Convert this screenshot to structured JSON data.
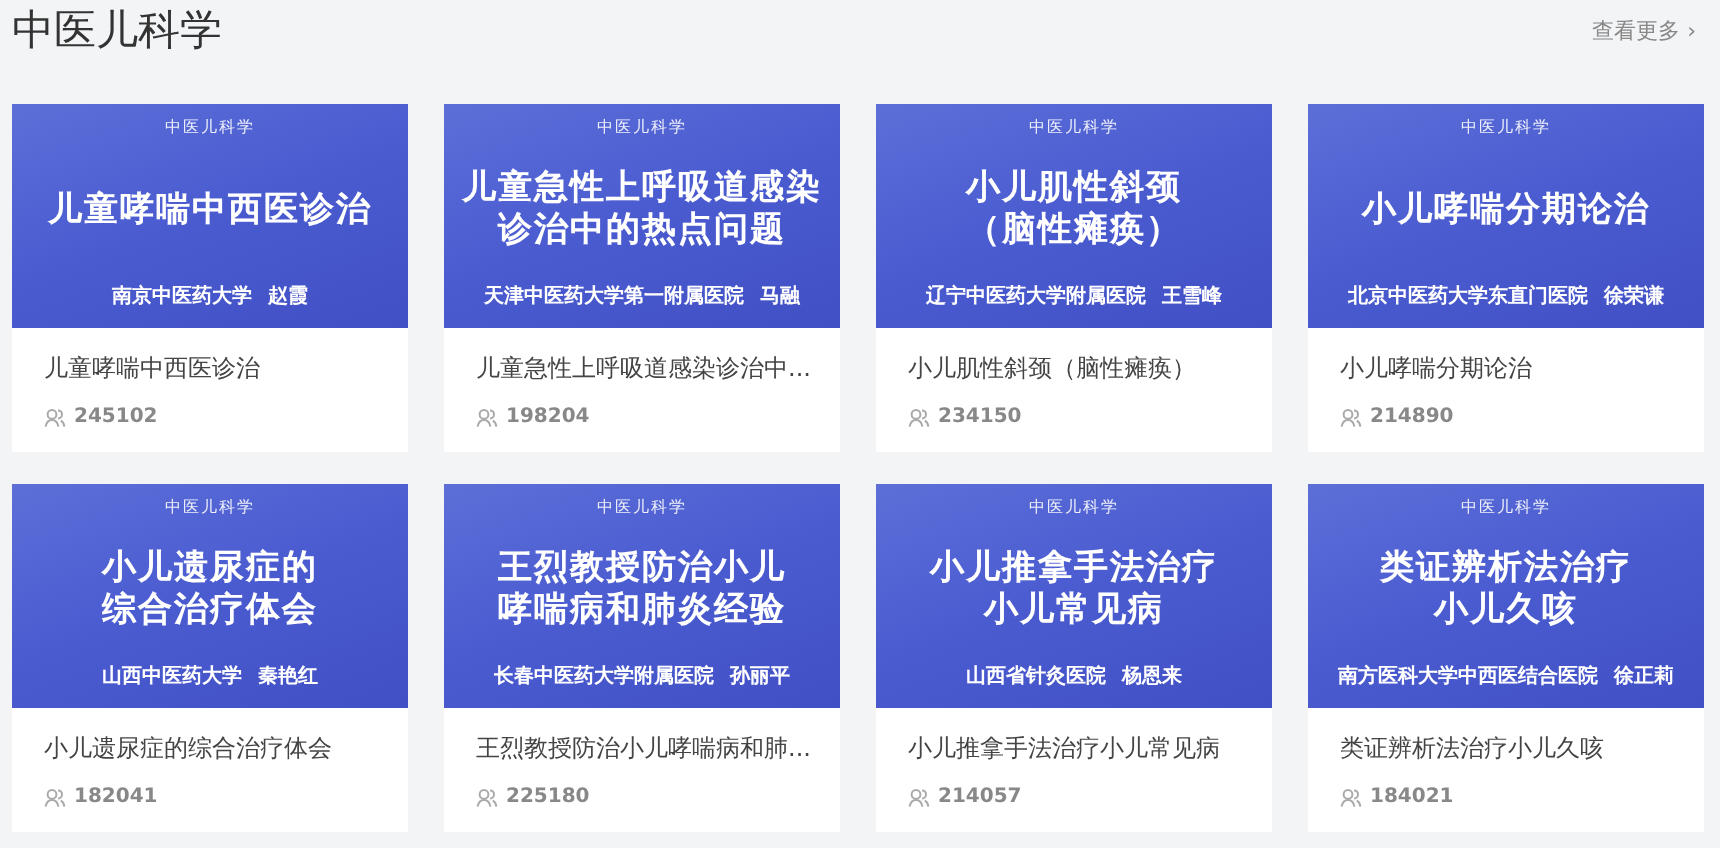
{
  "section": {
    "title": "中医儿科学",
    "more_link": "查看更多",
    "more_arrow": "›"
  },
  "courses": [
    {
      "cover": {
        "tag": "中医儿科学",
        "title_lines": [
          "儿童哮喘中西医诊治"
        ],
        "institution": "南京中医药大学",
        "lecturer": "赵霞"
      },
      "title": "儿童哮喘中西医诊治",
      "views": "245102"
    },
    {
      "cover": {
        "tag": "中医儿科学",
        "title_lines": [
          "儿童急性上呼吸道感染",
          "诊治中的热点问题"
        ],
        "institution": "天津中医药大学第一附属医院",
        "lecturer": "马融"
      },
      "title": "儿童急性上呼吸道感染诊治中...",
      "views": "198204"
    },
    {
      "cover": {
        "tag": "中医儿科学",
        "title_lines": [
          "小儿肌性斜颈",
          "（脑性瘫痪）"
        ],
        "institution": "辽宁中医药大学附属医院",
        "lecturer": "王雪峰"
      },
      "title": "小儿肌性斜颈（脑性瘫痪）",
      "views": "234150"
    },
    {
      "cover": {
        "tag": "中医儿科学",
        "title_lines": [
          "小儿哮喘分期论治"
        ],
        "institution": "北京中医药大学东直门医院",
        "lecturer": "徐荣谦"
      },
      "title": "小儿哮喘分期论治",
      "views": "214890"
    },
    {
      "cover": {
        "tag": "中医儿科学",
        "title_lines": [
          "小儿遗尿症的",
          "综合治疗体会"
        ],
        "institution": "山西中医药大学",
        "lecturer": "秦艳红"
      },
      "title": "小儿遗尿症的综合治疗体会",
      "views": "182041"
    },
    {
      "cover": {
        "tag": "中医儿科学",
        "title_lines": [
          "王烈教授防治小儿",
          "哮喘病和肺炎经验"
        ],
        "institution": "长春中医药大学附属医院",
        "lecturer": "孙丽平"
      },
      "title": "王烈教授防治小儿哮喘病和肺...",
      "views": "225180"
    },
    {
      "cover": {
        "tag": "中医儿科学",
        "title_lines": [
          "小儿推拿手法治疗",
          "小儿常见病"
        ],
        "institution": "山西省针灸医院",
        "lecturer": "杨恩来"
      },
      "title": "小儿推拿手法治疗小儿常见病",
      "views": "214057"
    },
    {
      "cover": {
        "tag": "中医儿科学",
        "title_lines": [
          "类证辨析法治疗",
          "小儿久咳"
        ],
        "institution": "南方医科大学中西医结合医院",
        "lecturer": "徐正莉"
      },
      "title": "类证辨析法治疗小儿久咳",
      "views": "184021"
    }
  ]
}
